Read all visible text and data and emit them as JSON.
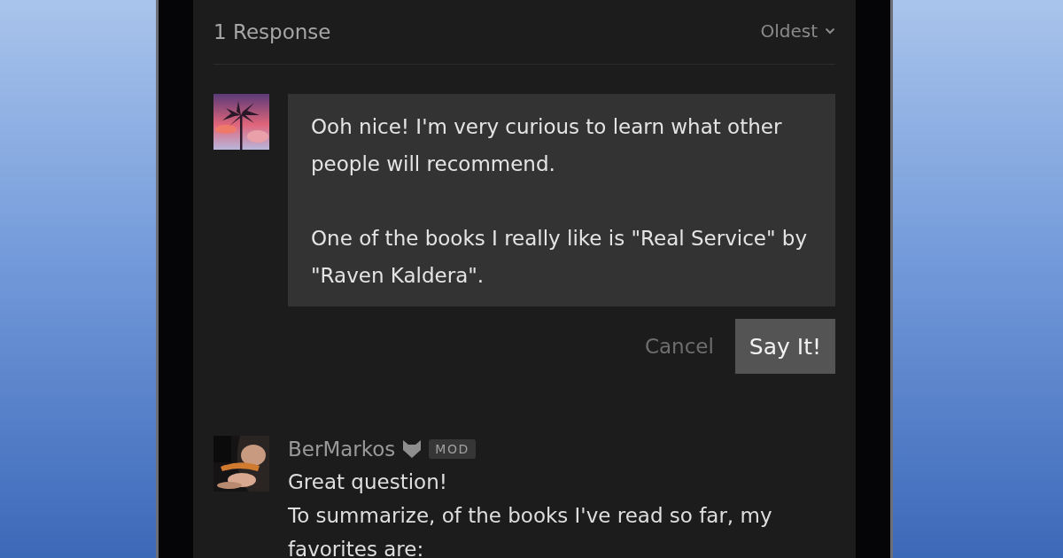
{
  "header": {
    "count": "1 Response",
    "sort": "Oldest"
  },
  "reply": {
    "value": [
      "Ooh nice! I'm very curious to learn what other people will recommend.",
      "One of the books I really like is \"Real Service\" by \"Raven Kaldera\"."
    ],
    "buttons": [
      {
        "kind": "cancel",
        "label": "Cancel"
      },
      {
        "kind": "submit",
        "label": "Say It!"
      }
    ]
  },
  "comments": [
    {
      "author": "BerMarkos",
      "badge": "MOD",
      "body": [
        "Great question!",
        "To summarize, of the books I've read so far, my favorites are:"
      ]
    }
  ]
}
